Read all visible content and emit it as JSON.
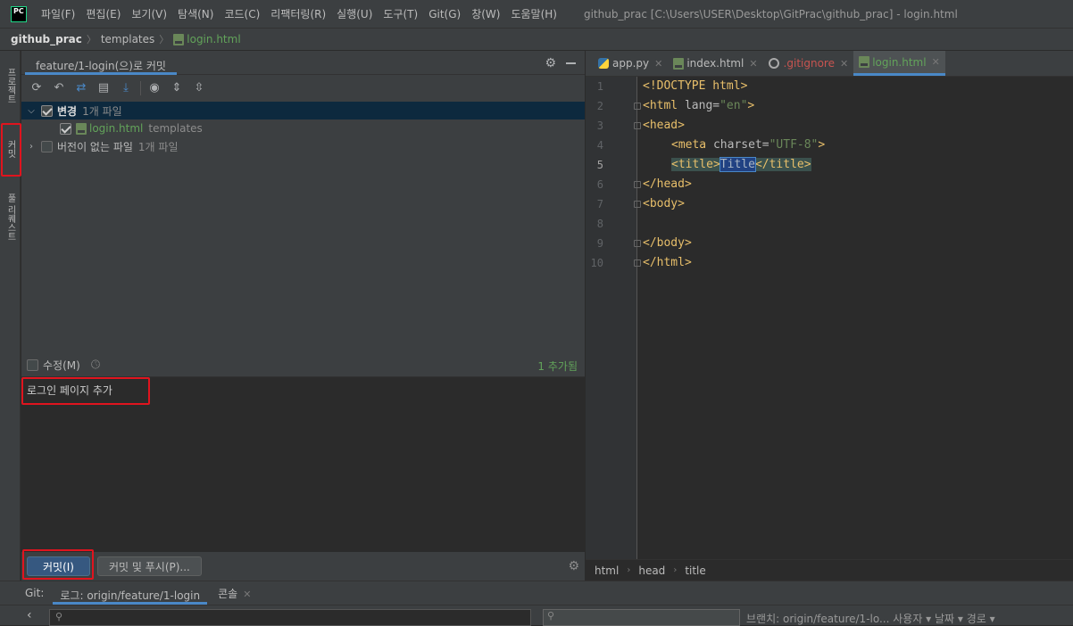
{
  "app": {
    "logo": "PC"
  },
  "menu": [
    "파일(F)",
    "편집(E)",
    "보기(V)",
    "탐색(N)",
    "코드(C)",
    "리팩터링(R)",
    "실행(U)",
    "도구(T)",
    "Git(G)",
    "창(W)",
    "도움말(H)"
  ],
  "window_title": "github_prac [C:\\Users\\USER\\Desktop\\GitPrac\\github_prac] - login.html",
  "breadcrumb": {
    "project": "github_prac",
    "folder": "templates",
    "file": "login.html"
  },
  "left_strip": {
    "project_tab": "프로젝트",
    "commit_tab": "커밋",
    "pull_requests_tab": "풀 리퀘스트"
  },
  "commit_panel": {
    "tab_title": "feature/1-login(으)로 커밋",
    "changes": {
      "label": "변경",
      "count": "1개 파일"
    },
    "file": {
      "name": "login.html",
      "folder": "templates"
    },
    "unversioned": {
      "label": "버전이 없는 파일",
      "count": "1개 파일"
    },
    "amend_label": "수정(M)",
    "added_count": "1 추가됨",
    "message": "로그인 페이지 추가",
    "commit_button": "커밋(I)",
    "commit_push_button": "커밋 및 푸시(P)..."
  },
  "editor": {
    "tabs": [
      {
        "label": "app.py",
        "icon": "python-file-icon",
        "color": "#bbbbbb"
      },
      {
        "label": "index.html",
        "icon": "html-file-icon",
        "color": "#bbbbbb"
      },
      {
        "label": ".gitignore",
        "icon": "git-ignore-icon",
        "color": "#c75450"
      },
      {
        "label": "login.html",
        "icon": "html-file-icon",
        "color": "#62a35a"
      }
    ],
    "line_numbers": [
      "1",
      "2",
      "3",
      "4",
      "5",
      "6",
      "7",
      "8",
      "9",
      "10"
    ],
    "current_line": "5",
    "code": {
      "l1": "<!DOCTYPE html>",
      "l2_open": "<html ",
      "l2_attr": "lang=",
      "l2_val": "\"en\"",
      "l2_close": ">",
      "l3": "<head>",
      "l4_open": "<meta ",
      "l4_attr": "charset=",
      "l4_val": "\"UTF-8\"",
      "l4_close": ">",
      "l5_open": "<title>",
      "l5_text": "Title",
      "l5_close": "</title>",
      "l6": "</head>",
      "l7": "<body>",
      "l9": "</body>",
      "l10": "</html>"
    },
    "breadcrumb": [
      "html",
      "head",
      "title"
    ]
  },
  "git_bar": {
    "label": "Git:",
    "log_tab": "로그: origin/feature/1-login",
    "console_tab": "콘솔",
    "filters": "브랜치: origin/feature/1-lo...  사용자 ▾  날짜 ▾  경로 ▾"
  }
}
